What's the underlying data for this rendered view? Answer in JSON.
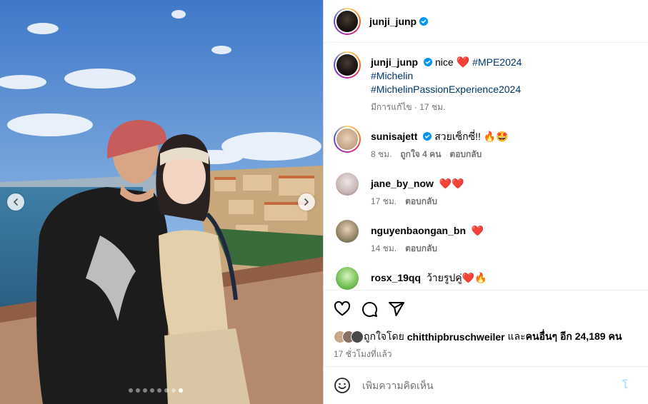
{
  "post": {
    "author": "junji_junp",
    "caption_text": "nice",
    "caption_heart": "❤️",
    "hashtags": [
      "#MPE2024",
      "#Michelin",
      "#MichelinPassionExperience2024"
    ],
    "caption_meta": "มีการแก้ไข · 17 ชม."
  },
  "comments": [
    {
      "user": "sunisajett",
      "verified": true,
      "text": "สวยเซ็กซี่!! 🔥🤩",
      "time": "8 ชม.",
      "likes": "ถูกใจ 4 คน",
      "reply": "ตอบกลับ"
    },
    {
      "user": "jane_by_now",
      "verified": false,
      "text": "❤️❤️",
      "time": "17 ชม.",
      "reply": "ตอบกลับ"
    },
    {
      "user": "nguyenbaongan_bn",
      "verified": false,
      "text": "❤️",
      "time": "14 ชม.",
      "reply": "ตอบกลับ"
    },
    {
      "user": "rosx_19qq",
      "verified": false,
      "text": "ว้ายรูปคู่❤️🔥"
    }
  ],
  "likes_line": {
    "prefix": "ถูกใจโดย",
    "first_liker": "chitthipbruschweiler",
    "and": "และ",
    "others": "คนอื่นๆ อีก 24,189 คน"
  },
  "posted_ago": "17 ชั่วโมงที่แล้ว",
  "add_comment": {
    "placeholder": "เพิ่มความคิดเห็น",
    "post_label": "โ"
  },
  "icons": {
    "like": "heart-outline-icon",
    "comment": "speech-bubble-icon",
    "share": "paper-plane-icon",
    "emoji": "smiley-icon",
    "verified": "blue-check-icon"
  },
  "colors": {
    "verified": "#0095f6",
    "hashtag": "#00376b",
    "muted": "#737373",
    "post_button": "#b2dffc"
  },
  "carousel": {
    "total_slides": 8,
    "active_slide": 7
  }
}
